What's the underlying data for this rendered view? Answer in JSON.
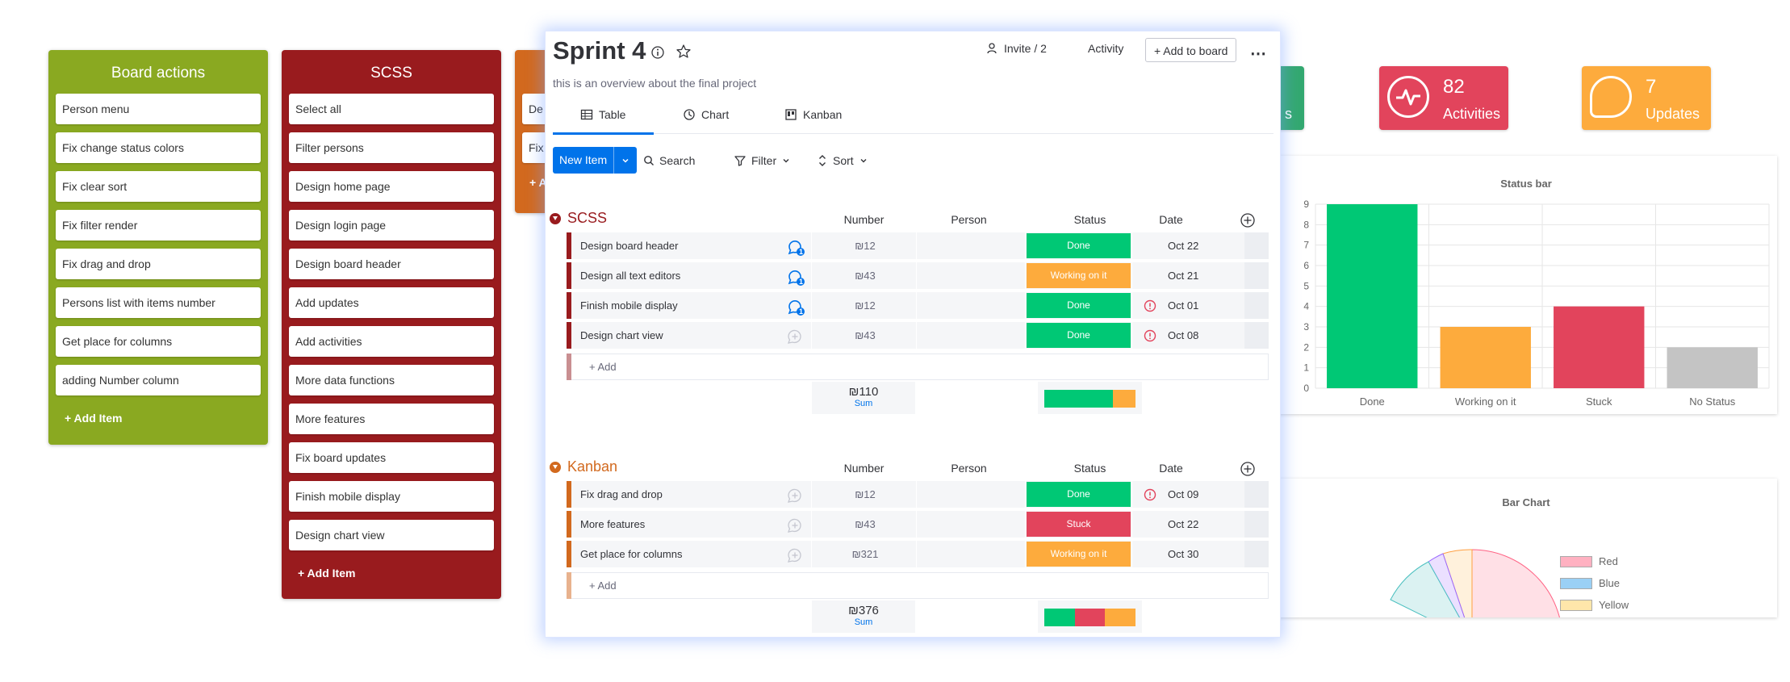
{
  "columns": [
    {
      "title": "Board actions",
      "color": "#8aa921",
      "items": [
        "Person menu",
        "Fix change status colors",
        "Fix clear sort",
        "Fix filter render",
        "Fix drag and drop",
        "Persons list with items number",
        "Get place for columns",
        "adding Number column"
      ],
      "add_label": "+ Add Item"
    },
    {
      "title": "SCSS",
      "color": "#991b1e",
      "items": [
        "Select all",
        "Filter persons",
        "Design home page",
        "Design login page",
        "Design board header",
        "Add updates",
        "Add activities",
        "More data functions",
        "More features",
        "Fix board updates",
        "Finish mobile display",
        "Design chart view"
      ],
      "add_label": "+ Add Item"
    },
    {
      "title": "",
      "color": "#d2691e",
      "items": [
        "De",
        "Fix"
      ],
      "add_label": "+ A"
    }
  ],
  "stats": [
    {
      "number": "82",
      "label": "Activities",
      "color": "#e2445c",
      "icon": "activity-icon"
    },
    {
      "number": "7",
      "label": "Updates",
      "color": "#fdab3d",
      "icon": "chat-bubble-icon"
    }
  ],
  "stat_partial": {
    "label": "s",
    "color": "#33a870"
  },
  "status_chart": {
    "chart_data": {
      "type": "bar",
      "title": "Status bar",
      "categories": [
        "Done",
        "Working on it",
        "Stuck",
        "No Status"
      ],
      "values": [
        9,
        3,
        4,
        2
      ],
      "colors": [
        "#00c875",
        "#fdab3d",
        "#e2445c",
        "#c4c4c4"
      ],
      "ylim": [
        0,
        9
      ],
      "yticks": [
        "0",
        "1",
        "2",
        "3",
        "4",
        "5",
        "6",
        "7",
        "8",
        "9"
      ],
      "grid": true
    }
  },
  "pie_chart": {
    "title": "Bar Chart",
    "legend": [
      {
        "label": "Red",
        "color": "#ffb1c1"
      },
      {
        "label": "Blue",
        "color": "#9ad0f5"
      },
      {
        "label": "Yellow",
        "color": "#ffe6aa"
      }
    ]
  },
  "board": {
    "title": "Sprint 4",
    "subtitle": "this is an overview about the final project",
    "invite_label": "Invite / 2",
    "activity_label": "Activity",
    "add_to_board_label": "+ Add to board",
    "more_icon": "more-icon",
    "tabs": [
      {
        "label": "Table",
        "icon": "table-icon"
      },
      {
        "label": "Chart",
        "icon": "chart-icon"
      },
      {
        "label": "Kanban",
        "icon": "kanban-icon"
      }
    ],
    "new_item_label": "New Item",
    "search_label": "Search",
    "filter_label": "Filter",
    "sort_label": "Sort",
    "columns": {
      "number": "Number",
      "person": "Person",
      "status": "Status",
      "date": "Date"
    },
    "groups": [
      {
        "name": "SCSS",
        "color": "#991b1e",
        "light_color": "#c98f91",
        "rows": [
          {
            "name": "Design board header",
            "number": "₪12",
            "status": "Done",
            "status_color": "#00c875",
            "date": "Oct 22",
            "updates": "1",
            "alert": false
          },
          {
            "name": "Design all text editors",
            "number": "₪43",
            "status": "Working on it",
            "status_color": "#fdab3d",
            "date": "Oct 21",
            "updates": "1",
            "alert": false
          },
          {
            "name": "Finish mobile display",
            "number": "₪12",
            "status": "Done",
            "status_color": "#00c875",
            "date": "Oct 01",
            "updates": "1",
            "alert": true
          },
          {
            "name": "Design chart view",
            "number": "₪43",
            "status": "Done",
            "status_color": "#00c875",
            "date": "Oct 08",
            "updates": "",
            "alert": true
          }
        ],
        "add_label": "+ Add",
        "sum_value": "₪110",
        "sum_label": "Sum",
        "summary_bar": [
          {
            "color": "#00c875",
            "fraction": 0.75
          },
          {
            "color": "#fdab3d",
            "fraction": 0.25
          }
        ]
      },
      {
        "name": "Kanban",
        "color": "#d2691e",
        "light_color": "#e8b28e",
        "rows": [
          {
            "name": "Fix drag and drop",
            "number": "₪12",
            "status": "Done",
            "status_color": "#00c875",
            "date": "Oct 09",
            "updates": "",
            "alert": true
          },
          {
            "name": "More features",
            "number": "₪43",
            "status": "Stuck",
            "status_color": "#e2445c",
            "date": "Oct 22",
            "updates": "",
            "alert": false
          },
          {
            "name": "Get place for columns",
            "number": "₪321",
            "status": "Working on it",
            "status_color": "#fdab3d",
            "date": "Oct 30",
            "updates": "",
            "alert": false
          }
        ],
        "add_label": "+ Add",
        "sum_value": "₪376",
        "sum_label": "Sum",
        "summary_bar": [
          {
            "color": "#00c875",
            "fraction": 0.333
          },
          {
            "color": "#e2445c",
            "fraction": 0.333
          },
          {
            "color": "#fdab3d",
            "fraction": 0.334
          }
        ]
      }
    ]
  }
}
